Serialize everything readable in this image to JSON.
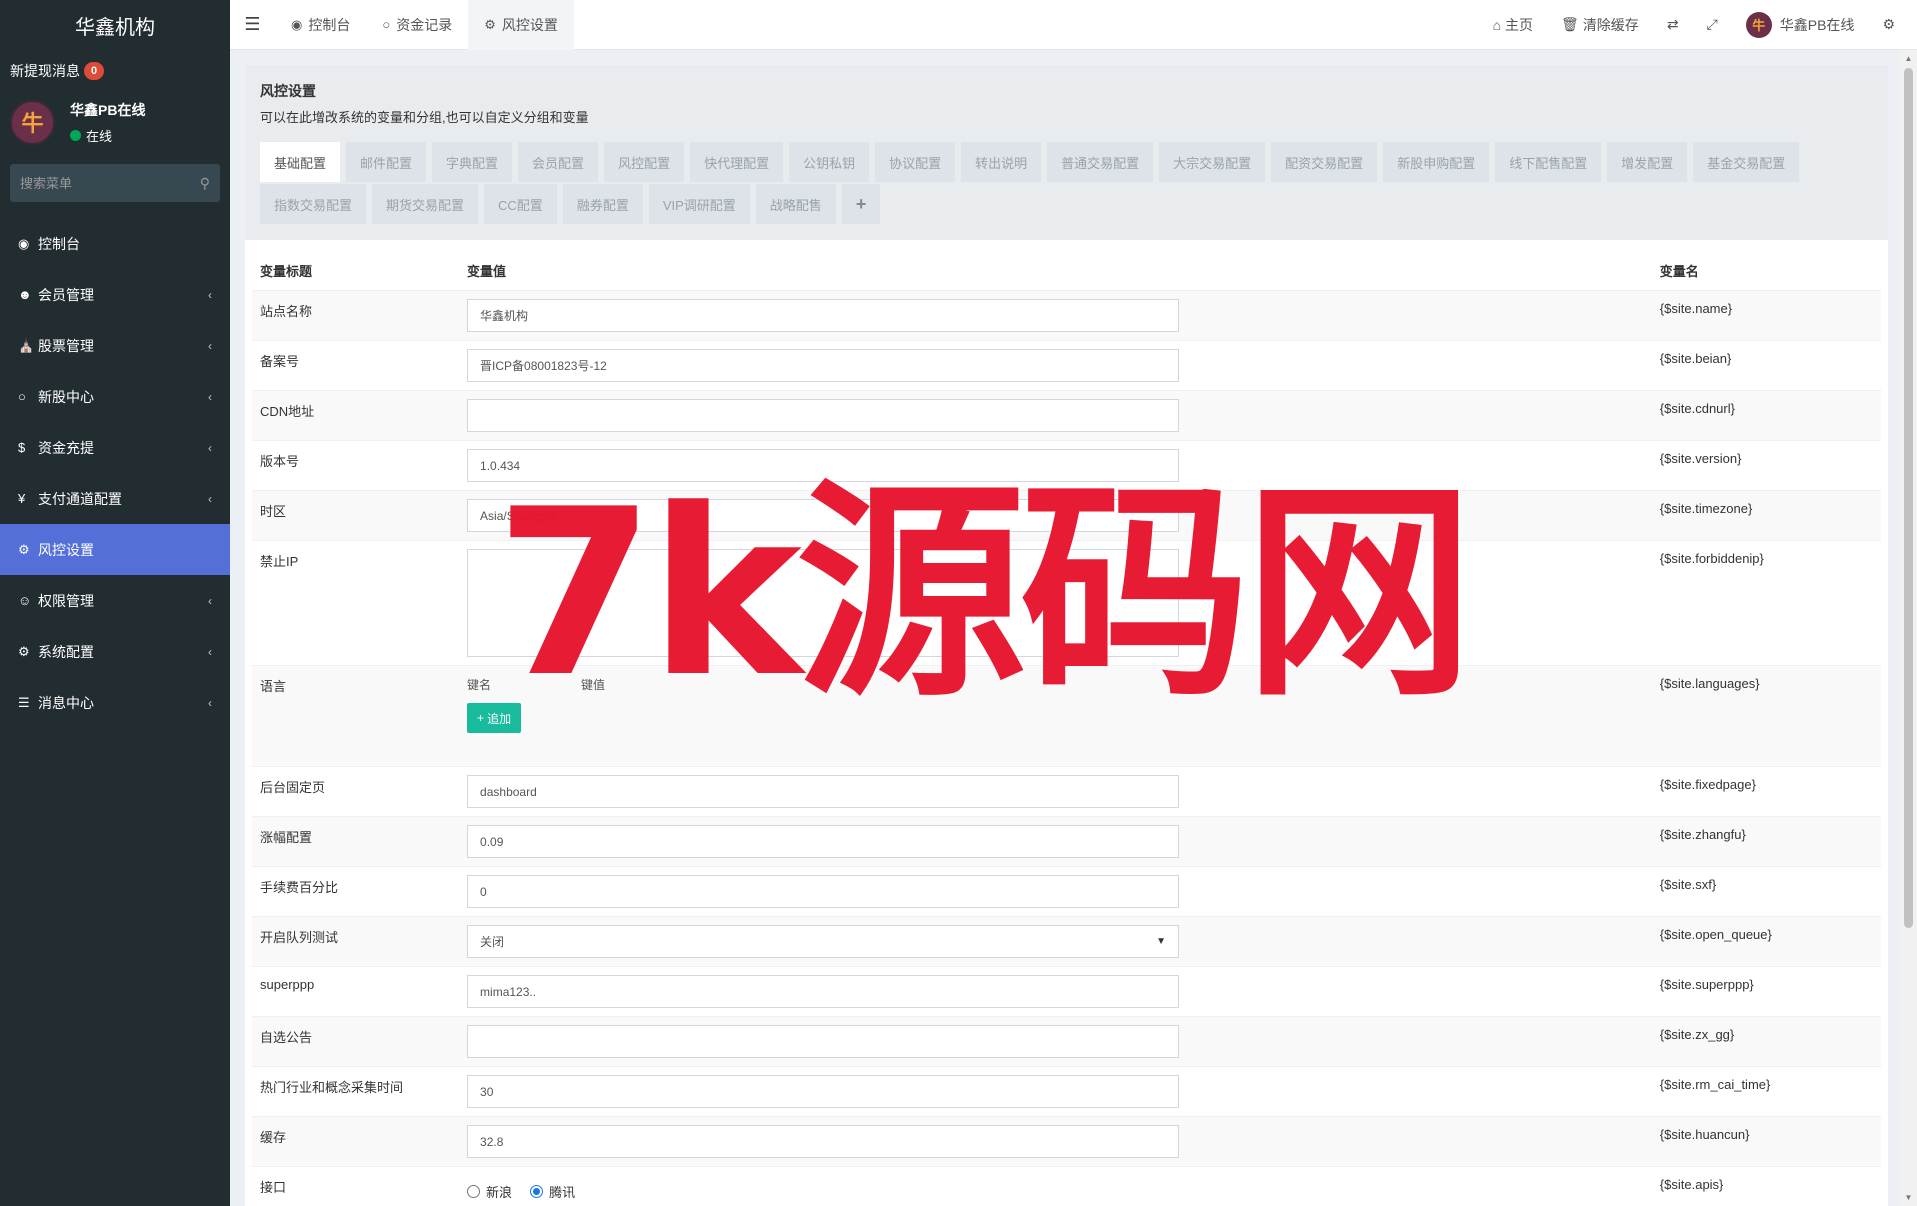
{
  "sidebar": {
    "brand": "华鑫机构",
    "notice_label": "新提现消息",
    "notice_count": "0",
    "user": {
      "name": "华鑫PB在线",
      "status": "在线",
      "avatar_glyph": "牛"
    },
    "search_placeholder": "搜索菜单",
    "menu": [
      {
        "icon": "dashboard-icon",
        "label": "控制台",
        "has_children": false
      },
      {
        "icon": "user-circle-icon",
        "label": "会员管理",
        "has_children": true
      },
      {
        "icon": "bank-icon",
        "label": "股票管理",
        "has_children": true
      },
      {
        "icon": "circle-icon",
        "label": "新股中心",
        "has_children": true
      },
      {
        "icon": "dollar-icon",
        "label": "资金充提",
        "has_children": true
      },
      {
        "icon": "yen-icon",
        "label": "支付通道配置",
        "has_children": true
      },
      {
        "icon": "gear-icon",
        "label": "风控设置",
        "has_children": false,
        "active": true
      },
      {
        "icon": "group-icon",
        "label": "权限管理",
        "has_children": true
      },
      {
        "icon": "cog-icon",
        "label": "系统配置",
        "has_children": true
      },
      {
        "icon": "list-icon",
        "label": "消息中心",
        "has_children": true
      }
    ]
  },
  "topbar": {
    "tabs": [
      {
        "icon": "dashboard-icon",
        "label": "控制台"
      },
      {
        "icon": "circle-icon",
        "label": "资金记录"
      },
      {
        "icon": "gear-icon",
        "label": "风控设置",
        "active": true
      }
    ],
    "right": {
      "home": "主页",
      "clear_cache": "清除缓存",
      "user": "华鑫PB在线"
    }
  },
  "panel": {
    "title": "风控设置",
    "description": "可以在此增改系统的变量和分组,也可以自定义分组和变量",
    "tabs": [
      "基础配置",
      "邮件配置",
      "字典配置",
      "会员配置",
      "风控配置",
      "快代理配置",
      "公钥私钥",
      "协议配置",
      "转出说明",
      "普通交易配置",
      "大宗交易配置",
      "配资交易配置",
      "新股申购配置",
      "线下配售配置",
      "增发配置",
      "基金交易配置",
      "指数交易配置",
      "期货交易配置",
      "CC配置",
      "融券配置",
      "VIP调研配置",
      "战略配售"
    ],
    "active_tab": "基础配置"
  },
  "table": {
    "headers": {
      "title": "变量标题",
      "value": "变量值",
      "name": "变量名"
    },
    "rows": [
      {
        "title": "站点名称",
        "value": "华鑫机构",
        "name": "{$site.name}"
      },
      {
        "title": "备案号",
        "value": "晋ICP备08001823号-12",
        "name": "{$site.beian}"
      },
      {
        "title": "CDN地址",
        "value": "",
        "name": "{$site.cdnurl}"
      },
      {
        "title": "版本号",
        "value": "1.0.434",
        "name": "{$site.version}"
      },
      {
        "title": "时区",
        "value": "Asia/Shanghai",
        "name": "{$site.timezone}"
      },
      {
        "title": "禁止IP",
        "value": "",
        "name": "{$site.forbiddenip}"
      },
      {
        "title": "语言",
        "key_label": "键名",
        "value_label": "键值",
        "add_label": "追加",
        "name": "{$site.languages}"
      },
      {
        "title": "后台固定页",
        "value": "dashboard",
        "name": "{$site.fixedpage}"
      },
      {
        "title": "涨幅配置",
        "value": "0.09",
        "name": "{$site.zhangfu}"
      },
      {
        "title": "手续费百分比",
        "value": "0",
        "name": "{$site.sxf}"
      },
      {
        "title": "开启队列测试",
        "value": "关闭",
        "name": "{$site.open_queue}"
      },
      {
        "title": "superppp",
        "value": "mima123..",
        "name": "{$site.superppp}"
      },
      {
        "title": "自选公告",
        "value": "",
        "name": "{$site.zx_gg}"
      },
      {
        "title": "热门行业和概念采集时间",
        "value": "30",
        "name": "{$site.rm_cai_time}"
      },
      {
        "title": "缓存",
        "value": "32.8",
        "name": "{$site.huancun}"
      },
      {
        "title": "接口",
        "options": [
          "新浪",
          "腾讯"
        ],
        "selected": "腾讯",
        "name": "{$site.apis}"
      }
    ]
  },
  "watermark": "7k源码网"
}
